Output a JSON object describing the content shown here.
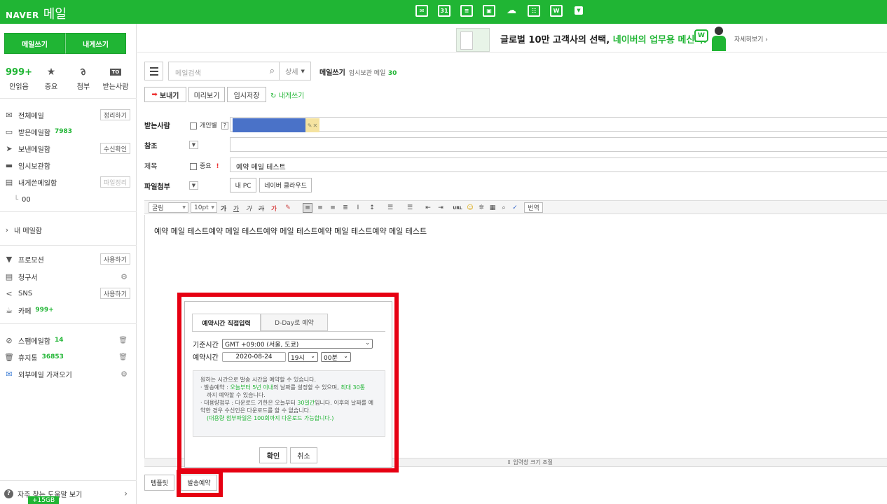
{
  "topbar": {
    "logo_brand": "NAVER",
    "logo_service": "메일",
    "icons": [
      "mail-home-icon",
      "calendar-icon",
      "contacts-list-icon",
      "address-book-icon",
      "cloud-icon",
      "memo-icon",
      "works-icon",
      "more-dropdown-icon"
    ],
    "calendar_day": "31",
    "works_letter": "W"
  },
  "sidebar": {
    "write_label": "메일쓰기",
    "self_write_label": "내게쓰기",
    "quick": [
      {
        "top": "999+",
        "label": "안읽음"
      },
      {
        "top": "★",
        "label": "중요"
      },
      {
        "top": "📎",
        "label": "첨부"
      },
      {
        "top": "TO",
        "label": "받는사람"
      }
    ],
    "folders": [
      {
        "label": "전체메일",
        "action": "정리하기"
      },
      {
        "label": "받은메일함",
        "count": "7983"
      },
      {
        "label": "보낸메일함",
        "action": "수신확인"
      },
      {
        "label": "임시보관함"
      },
      {
        "label": "내게쓴메일함",
        "action": "파일정리"
      },
      {
        "label": "00"
      }
    ],
    "my_mailbox": "내 메일함",
    "apps": [
      {
        "label": "프로모션",
        "action": "사용하기"
      },
      {
        "label": "청구서"
      },
      {
        "label": "SNS",
        "action": "사용하기"
      },
      {
        "label": "카페",
        "count": "999+"
      }
    ],
    "extra": [
      {
        "label": "스팸메일함",
        "count": "14"
      },
      {
        "label": "휴지통",
        "count": "36853"
      },
      {
        "label": "외부메일 가져오기"
      }
    ],
    "help_label": "자주 찾는 도움말 보기",
    "storage_badge": "+15GB"
  },
  "ad": {
    "text_plain": "글로벌 10만 고객사의 선택, ",
    "text_highlight": "네이버의 업무용 메신저!",
    "icon_letter": "W",
    "more_label": "자세히보기 ›"
  },
  "toolbar": {
    "search_placeholder": "메일검색",
    "detail_label": "상세",
    "page_title": "메일쓰기",
    "drafts_label": "임시보관 메일",
    "drafts_count": "30",
    "send_label": "보내기",
    "preview_label": "미리보기",
    "save_label": "임시저장",
    "self_label": "내게쓰기"
  },
  "form": {
    "to_label": "받는사람",
    "individual_label": "개인별",
    "help_mark": "?",
    "cc_label": "참조",
    "subject_label": "제목",
    "important_label": "중요",
    "important_mark": "!",
    "subject_value": "예약 메일 테스트",
    "attach_label": "파일첨부",
    "my_pc_label": "내 PC",
    "cloud_label": "네이버 클라우드"
  },
  "editor": {
    "font_label": "굴림",
    "size_label": "10pt",
    "translate_label": "번역",
    "body": "예약 메일 테스트예약 메일 테스트예약 메일 테스트예약 메일 테스트예약 메일 테스트",
    "resize_label": "⇕ 입력창 크기 조절"
  },
  "bottom": {
    "template_label": "템플릿",
    "schedule_label": "발송예약"
  },
  "popup": {
    "tab_direct": "예약시간 직접입력",
    "tab_dday": "D-Day로 예약",
    "base_time_label": "기준시간",
    "timezone_value": "GMT +09:00 (서울, 도쿄)",
    "reserve_time_label": "예약시간",
    "date_value": "2020-08-24",
    "hour_value": "19시",
    "minute_value": "00분",
    "info_title": "원하는 시간으로 발송 시간을 예약할 수 있습니다.",
    "info_send_a": "· 발송예약 : ",
    "info_send_b": "오늘부터 5년 이내",
    "info_send_c": "의 날짜를 설정할 수 있으며, ",
    "info_send_d": "최대 30통",
    "info_send_e": "까지 예약할 수 있습니다.",
    "info_large_a": "· 대용량첨부 : 다운로드 기한은 오늘부터 ",
    "info_large_b": "30일간",
    "info_large_c": "입니다. 이후의 날짜를 예약한 경우 수신인은 다운로드를 할 수 없습니다.",
    "info_large_d": "(대용량 첨부파일은 100회까지 다운로드 가능합니다.)",
    "ok_label": "확인",
    "cancel_label": "취소"
  },
  "colors": {
    "brand_green": "#20b534",
    "highlight_red": "#e60012",
    "recipient_chip": "#4a72c8"
  }
}
